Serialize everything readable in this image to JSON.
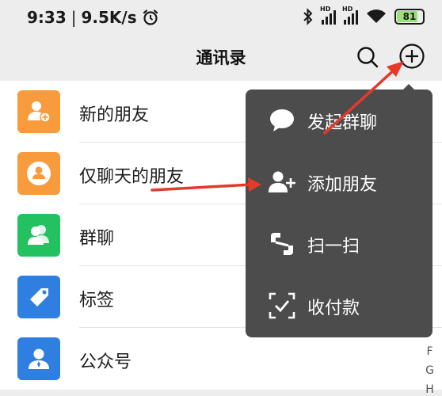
{
  "status_bar": {
    "time": "9:33",
    "separator": "|",
    "net_speed": "9.5K/s",
    "battery": "81",
    "signal_label_1": "HD",
    "signal_label_2": "HD",
    "battery_level": 0.81,
    "battery_color": "#9be07a"
  },
  "nav": {
    "title": "通讯录",
    "search_icon": "search-icon",
    "add_icon": "plus-circle-icon"
  },
  "list": {
    "items": [
      {
        "label": "新的朋友",
        "icon": "add-friend-icon",
        "color": "#f79b3c"
      },
      {
        "label": "仅聊天的朋友",
        "icon": "chat-only-icon",
        "color": "#f79b3c"
      },
      {
        "label": "群聊",
        "icon": "group-icon",
        "color": "#23c160"
      },
      {
        "label": "标签",
        "icon": "tag-icon",
        "color": "#2f7fe0"
      },
      {
        "label": "公众号",
        "icon": "official-account-icon",
        "color": "#2f7fe0"
      }
    ]
  },
  "index_bar": {
    "letters": [
      "F",
      "G",
      "H"
    ]
  },
  "menu": {
    "items": [
      {
        "label": "发起群聊",
        "icon": "chat-bubble-icon"
      },
      {
        "label": "添加朋友",
        "icon": "add-user-icon"
      },
      {
        "label": "扫一扫",
        "icon": "scan-icon"
      },
      {
        "label": "收付款",
        "icon": "payment-scan-icon"
      }
    ],
    "bg_color": "#4c4c4c"
  },
  "annotations": {
    "arrow_color": "#e53a2a"
  }
}
